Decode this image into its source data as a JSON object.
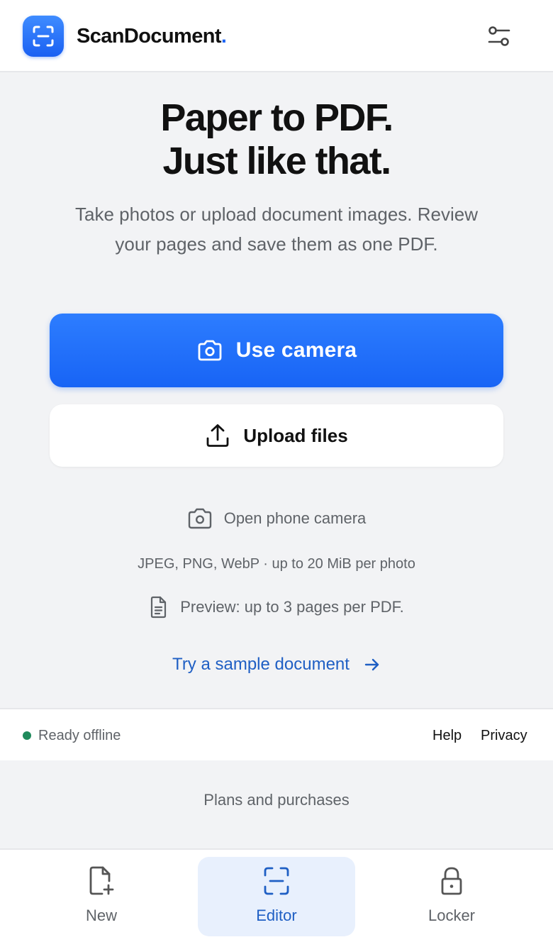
{
  "header": {
    "app_name": "ScanDocument",
    "app_name_dot": ".",
    "logo_icon": "scan-frame-icon",
    "settings_icon": "sliders-icon"
  },
  "hero": {
    "title_line1": "Paper to PDF.",
    "title_line2": "Just like that.",
    "subtitle": "Take photos or upload document images. Review your pages and save them as one PDF."
  },
  "actions": {
    "camera_label": "Use camera",
    "camera_icon": "camera-icon",
    "upload_label": "Upload files",
    "upload_icon": "upload-icon"
  },
  "info": {
    "phone_camera": "Open phone camera",
    "formats": "JPEG, PNG, WebP · up to 20 MiB per photo",
    "preview_limit": "Preview: up to 3 pages per PDF.",
    "sample_link": "Try a sample document"
  },
  "status": {
    "text": "Ready offline",
    "help": "Help",
    "privacy": "Privacy"
  },
  "plans": {
    "label": "Plans and purchases"
  },
  "nav": {
    "items": [
      {
        "label": "New",
        "icon": "new-file-icon",
        "active": false
      },
      {
        "label": "Editor",
        "icon": "scan-frame-icon",
        "active": true
      },
      {
        "label": "Locker",
        "icon": "lock-icon",
        "active": false
      }
    ]
  },
  "colors": {
    "accent": "#1f66f4",
    "link": "#1f5fc4",
    "status_ok": "#1f8a5b",
    "background": "#f2f3f5",
    "nav_active_bg": "#e8f0fd"
  }
}
